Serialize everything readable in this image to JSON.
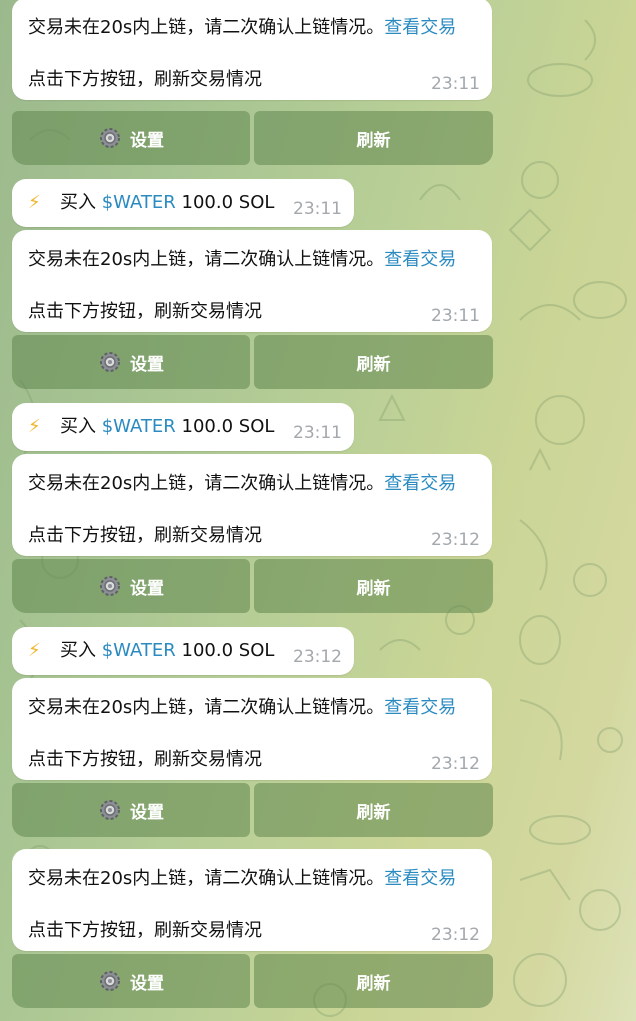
{
  "messages": [
    {
      "type": "status",
      "line1": "交易未在20s内上链，请二次确认上链情况。",
      "link": "查看交易",
      "line2": "点击下方按钮，刷新交易情况",
      "time": "23:11",
      "buttons": {
        "settings": "设置",
        "refresh": "刷新"
      }
    },
    {
      "type": "buy",
      "action": "买入",
      "ticker": "$WATER",
      "amount": "100.0 SOL",
      "time": "23:11"
    },
    {
      "type": "status",
      "line1": "交易未在20s内上链，请二次确认上链情况。",
      "link": "查看交易",
      "line2": "点击下方按钮，刷新交易情况",
      "time": "23:11",
      "buttons": {
        "settings": "设置",
        "refresh": "刷新"
      }
    },
    {
      "type": "buy",
      "action": "买入",
      "ticker": "$WATER",
      "amount": "100.0 SOL",
      "time": "23:11"
    },
    {
      "type": "status",
      "line1": "交易未在20s内上链，请二次确认上链情况。",
      "link": "查看交易",
      "line2": "点击下方按钮，刷新交易情况",
      "time": "23:12",
      "buttons": {
        "settings": "设置",
        "refresh": "刷新"
      }
    },
    {
      "type": "buy",
      "action": "买入",
      "ticker": "$WATER",
      "amount": "100.0 SOL",
      "time": "23:12"
    },
    {
      "type": "status",
      "line1": "交易未在20s内上链，请二次确认上链情况。",
      "link": "查看交易",
      "line2": "点击下方按钮，刷新交易情况",
      "time": "23:12",
      "buttons": {
        "settings": "设置",
        "refresh": "刷新"
      }
    },
    {
      "type": "status",
      "line1": "交易未在20s内上链，请二次确认上链情况。",
      "link": "查看交易",
      "line2": "点击下方按钮，刷新交易情况",
      "time": "23:12",
      "buttons": {
        "settings": "设置",
        "refresh": "刷新"
      }
    }
  ],
  "icons": {
    "buy": "lightning-bolt-icon",
    "settings": "gear-icon"
  },
  "colors": {
    "link": "#2b8bc1",
    "bolt": "#f2b52a",
    "keyboard_button": "#60874e"
  }
}
